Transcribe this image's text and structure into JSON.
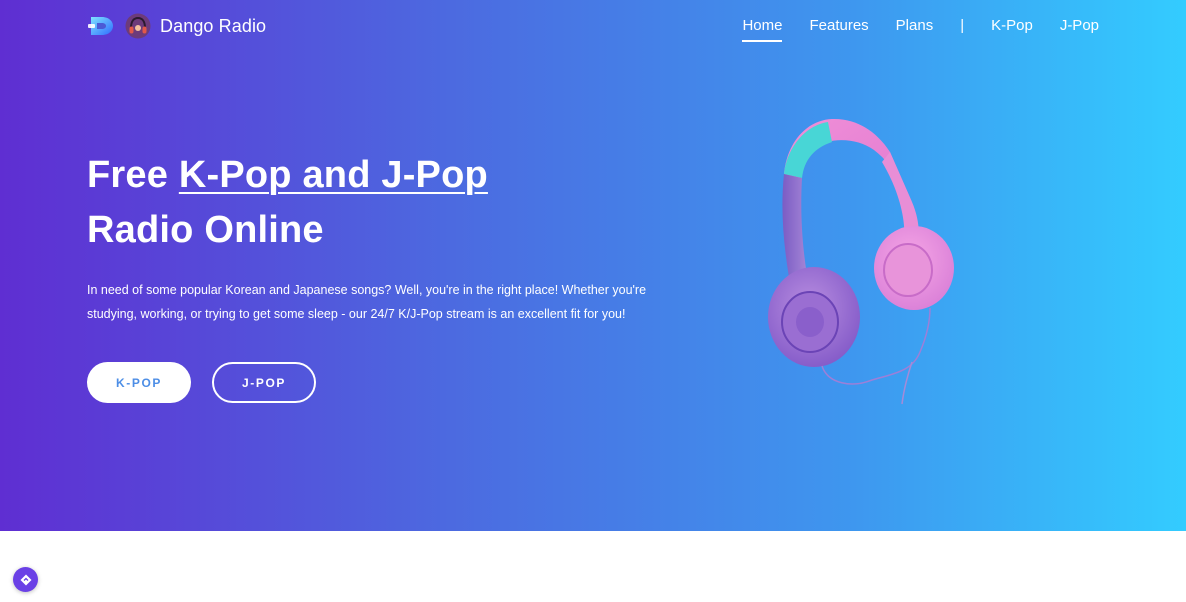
{
  "header": {
    "brand_name": "Dango Radio",
    "logo_icon": "dango-logo-icon",
    "avatar_icon": "headphones-avatar-icon",
    "nav": [
      {
        "label": "Home",
        "active": true
      },
      {
        "label": "Features"
      },
      {
        "label": "Plans"
      },
      {
        "label": "|",
        "separator": true
      },
      {
        "label": "K-Pop"
      },
      {
        "label": "J-Pop"
      }
    ]
  },
  "hero": {
    "headline_part1": "Free ",
    "headline_underlined": "K-Pop and J-Pop",
    "headline_part2": "Radio Online",
    "tagline": "In need of some popular Korean and Japanese songs? Well, you're in the right place! Whether you're studying, working, or trying to get some sleep - our 24/7 K/J-Pop stream is an excellent fit for you!",
    "buttons": [
      {
        "label": "K-POP"
      },
      {
        "label": "J-POP"
      }
    ],
    "illustration": "headphones-illustration-icon"
  },
  "colors": {
    "gradient_start": "#5f2ed2",
    "gradient_end": "#33ccff",
    "button_text": "#4d8ee6",
    "fab": "#6a40e6"
  },
  "fab_icon": "navigation-diamond-icon"
}
